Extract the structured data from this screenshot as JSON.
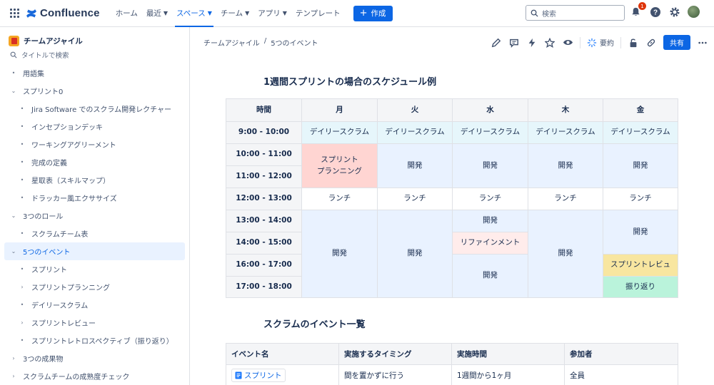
{
  "app": {
    "brand": "Confluence",
    "nav": [
      "ホーム",
      "最近",
      "スペース",
      "チーム",
      "アプリ",
      "テンプレート"
    ],
    "active_nav": "スペース",
    "create_label": "作成",
    "search_placeholder": "検索",
    "notification_count": "1",
    "icons": [
      "app-switcher-icon",
      "notification-icon",
      "help-icon",
      "settings-icon",
      "avatar"
    ]
  },
  "sidebar": {
    "space_name": "チームアジャイル",
    "filter_placeholder": "タイトルで検索",
    "items": [
      {
        "label": "用語集",
        "level": 0,
        "ctl": "•"
      },
      {
        "label": "スプリント0",
        "level": 0,
        "ctl": "⌄"
      },
      {
        "label": "Jira Software でのスクラム開発レクチャー",
        "level": 1,
        "ctl": "•"
      },
      {
        "label": "インセプションデッキ",
        "level": 1,
        "ctl": "•"
      },
      {
        "label": "ワーキングアグリーメント",
        "level": 1,
        "ctl": "•"
      },
      {
        "label": "完成の定義",
        "level": 1,
        "ctl": "•"
      },
      {
        "label": "星取表（スキルマップ）",
        "level": 1,
        "ctl": "•"
      },
      {
        "label": "ドラッカー風エクササイズ",
        "level": 1,
        "ctl": "•"
      },
      {
        "label": "3つのロール",
        "level": 0,
        "ctl": "⌄"
      },
      {
        "label": "スクラムチーム表",
        "level": 1,
        "ctl": "•"
      },
      {
        "label": "5つのイベント",
        "level": 0,
        "ctl": "⌄",
        "selected": true
      },
      {
        "label": "スプリント",
        "level": 1,
        "ctl": "•"
      },
      {
        "label": "スプリントプランニング",
        "level": 1,
        "ctl": "›"
      },
      {
        "label": "デイリースクラム",
        "level": 1,
        "ctl": "•"
      },
      {
        "label": "スプリントレビュー",
        "level": 1,
        "ctl": "›"
      },
      {
        "label": "スプリントレトロスペクティブ（振り返り）",
        "level": 1,
        "ctl": "•"
      },
      {
        "label": "3つの成果物",
        "level": 0,
        "ctl": "›"
      },
      {
        "label": "スクラムチームの成熟度チェック",
        "level": 0,
        "ctl": "›"
      }
    ]
  },
  "page": {
    "breadcrumb": [
      "チームアジャイル",
      "/",
      "5つのイベント"
    ],
    "summary_label": "要約",
    "share_label": "共有",
    "heading1": "1週間スプリントの場合のスケジュール例",
    "heading2": "スクラムのイベント一覧"
  },
  "schedule": {
    "header": [
      "時間",
      "月",
      "火",
      "水",
      "木",
      "金"
    ],
    "times": [
      "9:00 - 10:00",
      "10:00 - 11:00",
      "11:00 - 12:00",
      "12:00 - 13:00",
      "13:00 - 14:00",
      "14:00 - 15:00",
      "16:00 - 17:00",
      "17:00 - 18:00"
    ],
    "daily": "デイリースクラム",
    "planning": "スプリント\nプランニング",
    "dev": "開発",
    "lunch": "ランチ",
    "refinement": "リファインメント",
    "review": "スプリントレビュ",
    "retro": "振り返り"
  },
  "events_table": {
    "headers": [
      "イベント名",
      "実施するタイミング",
      "実施時間",
      "参加者"
    ],
    "rows": [
      [
        "スプリント",
        "間を置かずに行う",
        "1週間から1ヶ月",
        "全員"
      ]
    ]
  }
}
